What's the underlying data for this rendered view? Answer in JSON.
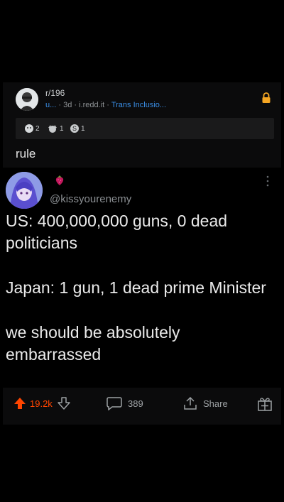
{
  "post": {
    "community": "r/196",
    "meta": {
      "user": "u...",
      "age": "3d",
      "domain": "i.redd.it",
      "flair": "Trans Inclusio..."
    },
    "awards": [
      {
        "icon": "helpful-award-icon",
        "count": "2"
      },
      {
        "icon": "wholesome-award-icon",
        "count": "1"
      },
      {
        "icon": "silver-award-icon",
        "count": "1"
      }
    ],
    "title": "rule"
  },
  "tweet": {
    "handle": "@kissyourenemy",
    "lines": [
      "US: 400,000,000 guns, 0 dead politicians",
      "Japan: 1 gun, 1 dead prime Minister",
      "we should be absolutely embarrassed"
    ]
  },
  "actions": {
    "upvotes": "19.2k",
    "comments": "389",
    "share_label": "Share"
  },
  "colors": {
    "upvote": "#ff4500",
    "flair_link": "#3a8ee6",
    "lock": "#f5a623"
  }
}
